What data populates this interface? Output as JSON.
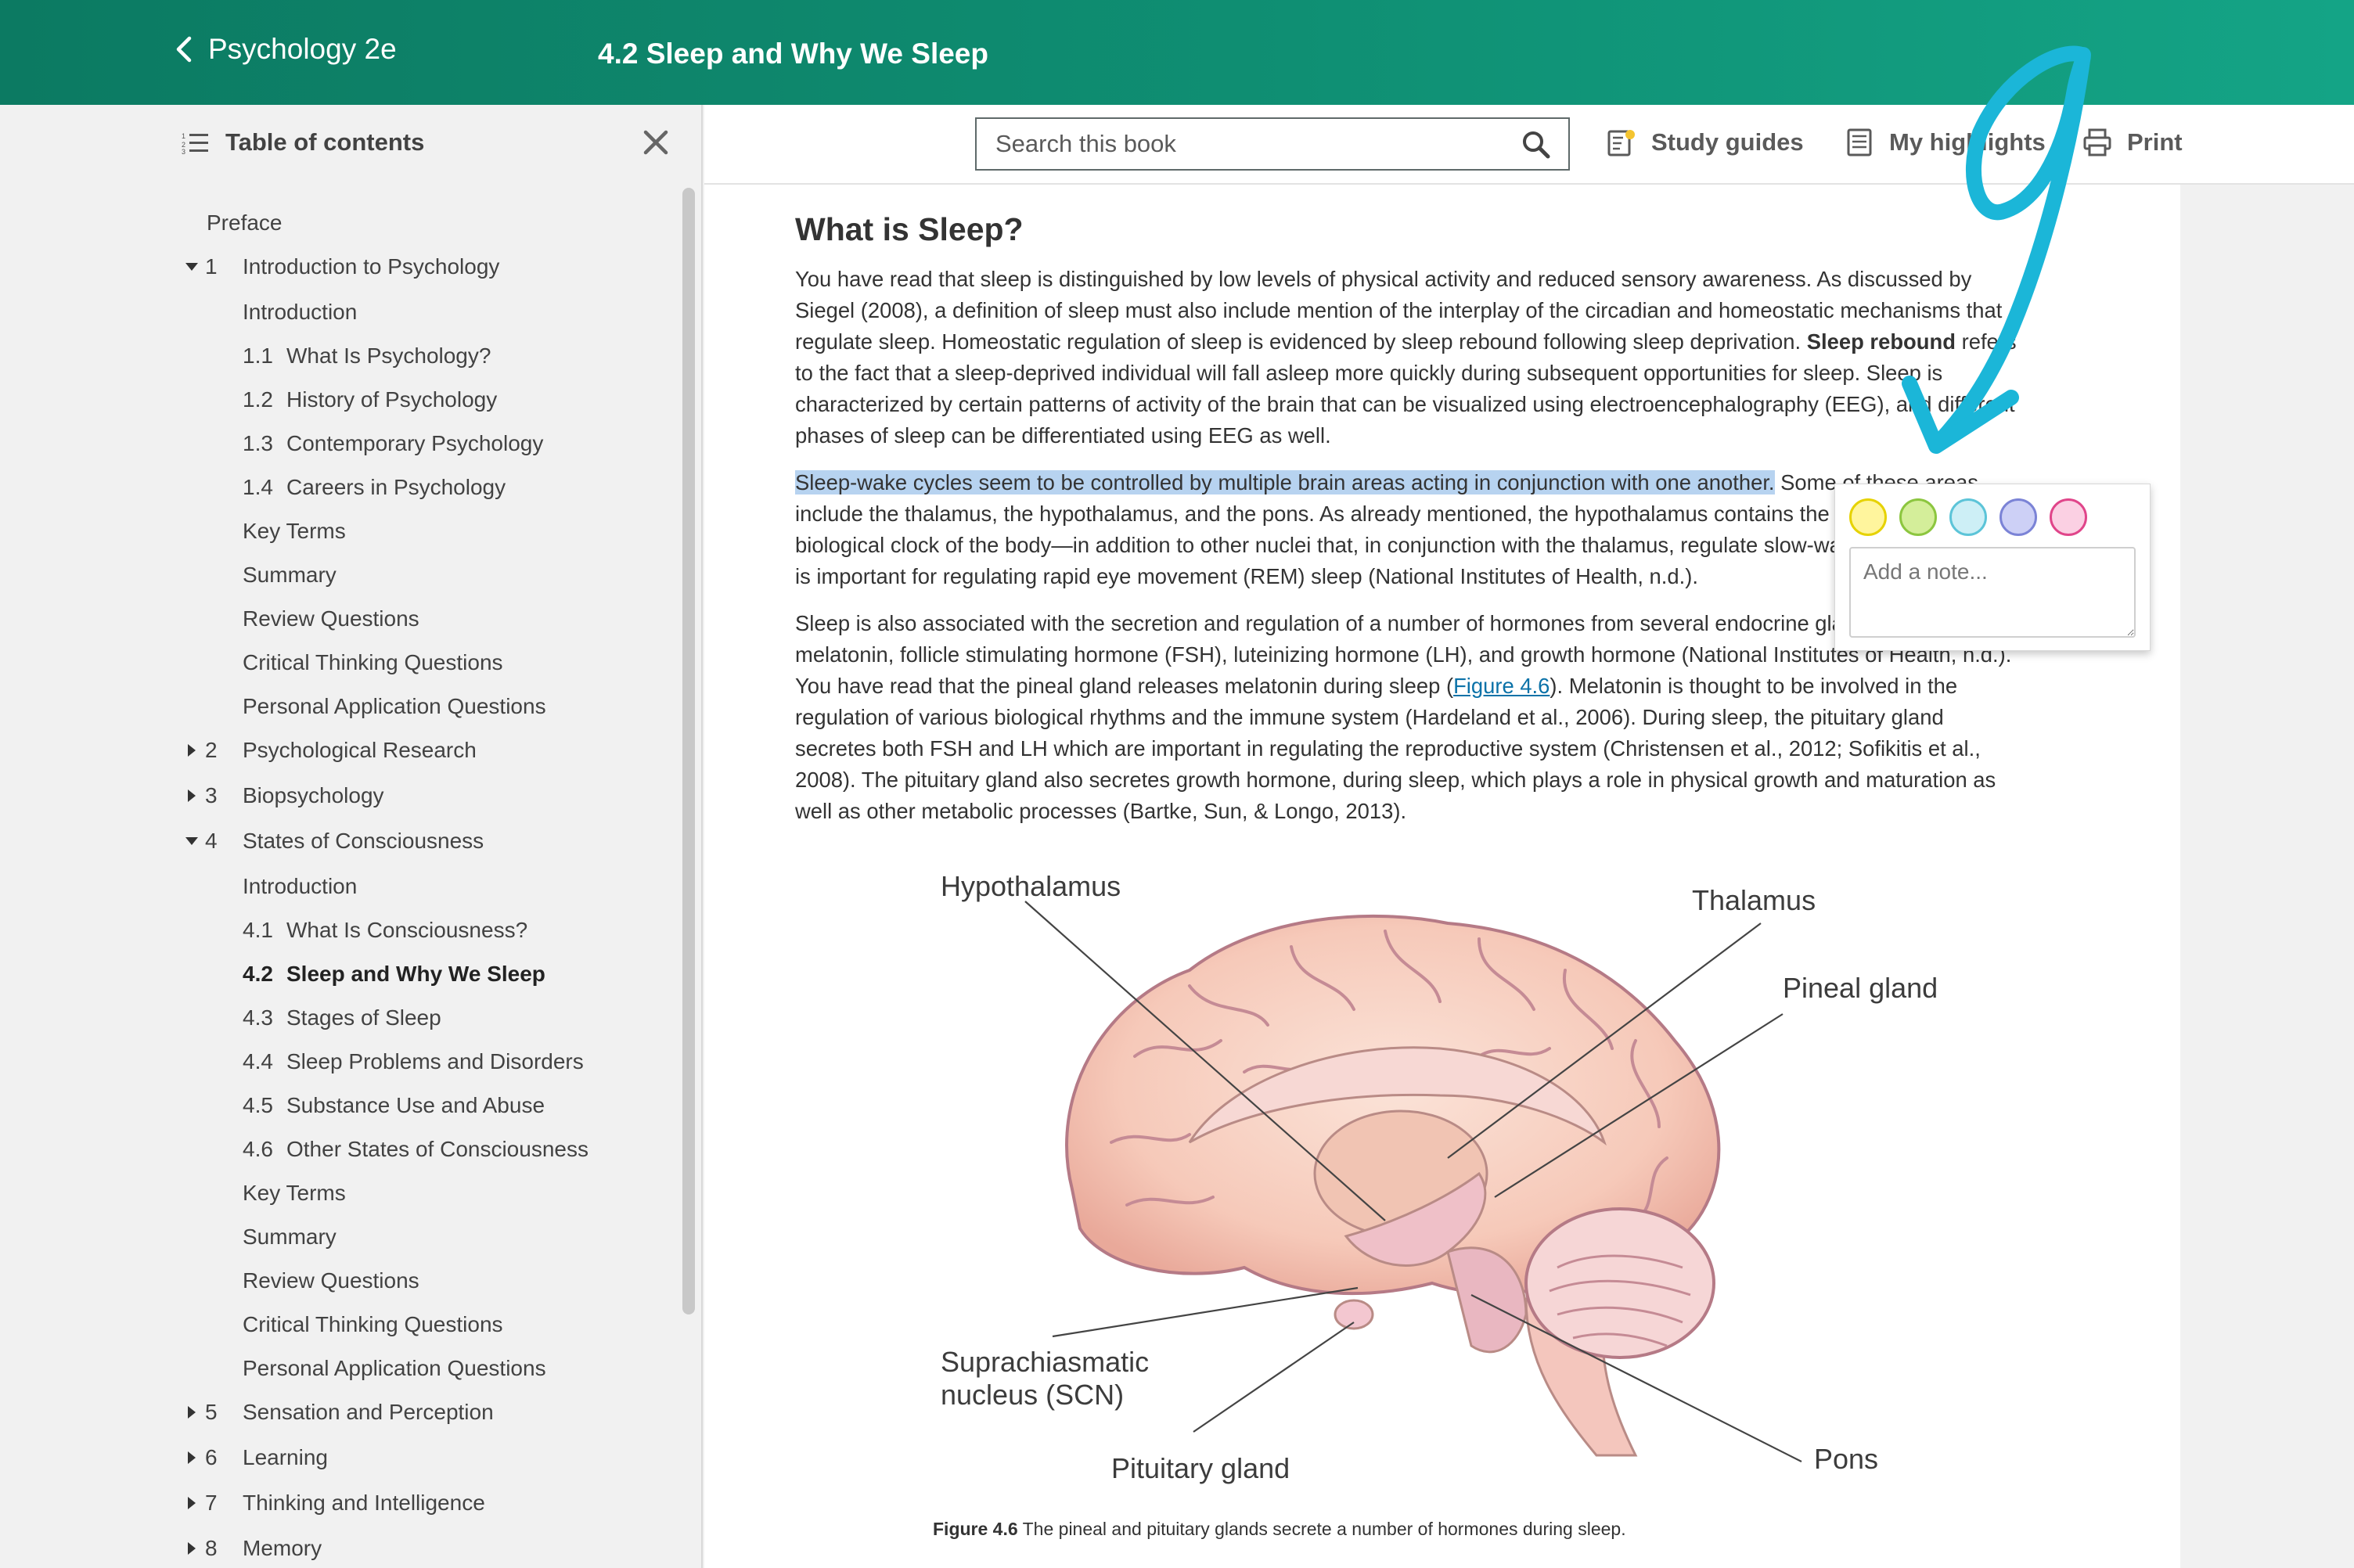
{
  "header": {
    "book_title": "Psychology 2e",
    "section_title": "4.2 Sleep and Why We Sleep"
  },
  "toc": {
    "header_label": "Table of contents",
    "items": [
      {
        "type": "plain-top",
        "label": "Preface"
      },
      {
        "type": "chapter",
        "caret": "down",
        "num": "1",
        "label": "Introduction to Psychology"
      },
      {
        "type": "plain",
        "label": "Introduction"
      },
      {
        "type": "section",
        "num": "1.1",
        "label": "What Is Psychology?"
      },
      {
        "type": "section",
        "num": "1.2",
        "label": "History of Psychology"
      },
      {
        "type": "section",
        "num": "1.3",
        "label": "Contemporary Psychology"
      },
      {
        "type": "section",
        "num": "1.4",
        "label": "Careers in Psychology"
      },
      {
        "type": "plain",
        "label": "Key Terms"
      },
      {
        "type": "plain",
        "label": "Summary"
      },
      {
        "type": "plain",
        "label": "Review Questions"
      },
      {
        "type": "plain",
        "label": "Critical Thinking Questions"
      },
      {
        "type": "plain",
        "label": "Personal Application Questions"
      },
      {
        "type": "chapter",
        "caret": "right",
        "num": "2",
        "label": "Psychological Research"
      },
      {
        "type": "chapter",
        "caret": "right",
        "num": "3",
        "label": "Biopsychology"
      },
      {
        "type": "chapter",
        "caret": "down",
        "num": "4",
        "label": "States of Consciousness"
      },
      {
        "type": "plain",
        "label": "Introduction"
      },
      {
        "type": "section",
        "num": "4.1",
        "label": "What Is Consciousness?"
      },
      {
        "type": "section",
        "num": "4.2",
        "label": "Sleep and Why We Sleep",
        "active": true
      },
      {
        "type": "section",
        "num": "4.3",
        "label": "Stages of Sleep"
      },
      {
        "type": "section",
        "num": "4.4",
        "label": "Sleep Problems and Disorders"
      },
      {
        "type": "section",
        "num": "4.5",
        "label": "Substance Use and Abuse"
      },
      {
        "type": "section",
        "num": "4.6",
        "label": "Other States of Consciousness"
      },
      {
        "type": "plain",
        "label": "Key Terms"
      },
      {
        "type": "plain",
        "label": "Summary"
      },
      {
        "type": "plain",
        "label": "Review Questions"
      },
      {
        "type": "plain",
        "label": "Critical Thinking Questions"
      },
      {
        "type": "plain",
        "label": "Personal Application Questions"
      },
      {
        "type": "chapter",
        "caret": "right",
        "num": "5",
        "label": "Sensation and Perception"
      },
      {
        "type": "chapter",
        "caret": "right",
        "num": "6",
        "label": "Learning"
      },
      {
        "type": "chapter",
        "caret": "right",
        "num": "7",
        "label": "Thinking and Intelligence"
      },
      {
        "type": "chapter",
        "caret": "right",
        "num": "8",
        "label": "Memory"
      }
    ]
  },
  "toolbar": {
    "search_placeholder": "Search this book",
    "study_guides": "Study guides",
    "my_highlights": "My highlights",
    "print": "Print"
  },
  "article": {
    "heading": "What is Sleep?",
    "p1_a": "You have read that sleep is distinguished by low levels of physical activity and reduced sensory awareness. As discussed by Siegel (2008), a definition of sleep must also include mention of the interplay of the circadian and homeostatic mechanisms that regulate sleep. Homeostatic regulation of sleep is evidenced by sleep rebound following sleep deprivation. ",
    "p1_bold": "Sleep rebound",
    "p1_b": " refers to the fact that a sleep-deprived individual will fall asleep more quickly during subsequent opportunities for sleep. Sleep is characterized by certain patterns of activity of the brain that can be visualized using electroencephalography (EEG), and different phases of sleep can be differentiated using EEG as well.",
    "p2_highlight": "Sleep-wake cycles seem to be controlled by multiple brain areas acting in conjunction with one another.",
    "p2_rest": " Some of these areas include the thalamus, the hypothalamus, and the pons. As already mentioned, the hypothalamus contains the SCN—the biological clock of the body—in addition to other nuclei that, in conjunction with the thalamus, regulate slow-wave sleep. The pons is important for regulating rapid eye movement (REM) sleep (National Institutes of Health, n.d.).",
    "p3_a": "Sleep is also associated with the secretion and regulation of a number of hormones from several endocrine glands including: melatonin, follicle stimulating hormone (FSH), luteinizing hormone (LH), and growth hormone (National Institutes of Health, n.d.). You have read that the pineal gland releases melatonin during sleep (",
    "p3_link": "Figure 4.6",
    "p3_b": "). Melatonin is thought to be involved in the regulation of various biological rhythms and the immune system (Hardeland et al., 2006). During sleep, the pituitary gland secretes both FSH and LH which are important in regulating the reproductive system (Christensen et al., 2012; Sofikitis et al., 2008). The pituitary gland also secretes growth hormone, during sleep, which plays a role in physical growth and maturation as well as other metabolic processes (Bartke, Sun, & Longo, 2013)."
  },
  "highlight_popup": {
    "colors": [
      {
        "name": "yellow",
        "fill": "#fff59d",
        "border": "#e6d200"
      },
      {
        "name": "green",
        "fill": "#d4ee9a",
        "border": "#8cc63f"
      },
      {
        "name": "blue",
        "fill": "#cdeff6",
        "border": "#5cc4d8"
      },
      {
        "name": "purple",
        "fill": "#cdd0f6",
        "border": "#7b83d6"
      },
      {
        "name": "pink",
        "fill": "#fbd0e3",
        "border": "#e0458a"
      }
    ],
    "note_placeholder": "Add a note..."
  },
  "figure": {
    "labels": {
      "hypothalamus": "Hypothalamus",
      "thalamus": "Thalamus",
      "pineal": "Pineal gland",
      "scn_line1": "Suprachiasmatic",
      "scn_line2": "nucleus (SCN)",
      "pituitary": "Pituitary gland",
      "pons": "Pons"
    },
    "caption_label": "Figure 4.6",
    "caption_text": " The pineal and pituitary glands secrete a number of hormones during sleep."
  },
  "colors": {
    "header_start": "#0c7a62",
    "header_end": "#14a486",
    "highlight": "#b7d3f0",
    "annotation": "#1bb6d8"
  }
}
